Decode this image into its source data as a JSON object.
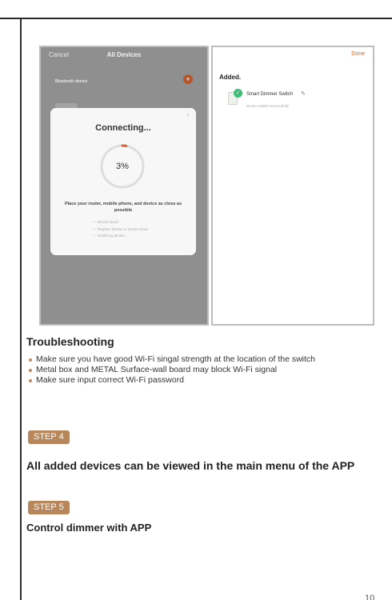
{
  "screenshot_left": {
    "cancel": "Cancel",
    "title": "All Devices",
    "bluetooth_device": "Bluetooth device",
    "plus": "+",
    "modal": {
      "close": "×",
      "title": "Connecting...",
      "progress_label": "3%",
      "progress_fraction": 0.03,
      "message": "Place your router, mobile phone, and device as close as possible",
      "steps": [
        "Device found",
        "Register Device to Smart Cloud",
        "Initializing device..."
      ]
    }
  },
  "screenshot_right": {
    "done": "Done",
    "added": "Added.",
    "check": "✓",
    "device_name": "Smart Dimmer Switch",
    "edit": "✎",
    "device_sub": "Device added successfully"
  },
  "troubleshooting": {
    "title": "Troubleshooting",
    "items": [
      "Make sure you have good Wi-Fi singal strength at the location of the switch",
      "Metal box and METAL Surface-wall board may block Wi-Fi signal",
      "Make sure input correct Wi-Fi password"
    ]
  },
  "step4": {
    "badge": "STEP 4",
    "text": "All added devices can be viewed in the main menu of the APP"
  },
  "step5": {
    "badge": "STEP 5",
    "text": "Control dimmer with APP"
  },
  "page_number": "10",
  "colors": {
    "accent": "#b7865a",
    "progress": "#d8632e",
    "success": "#3dbd75"
  }
}
